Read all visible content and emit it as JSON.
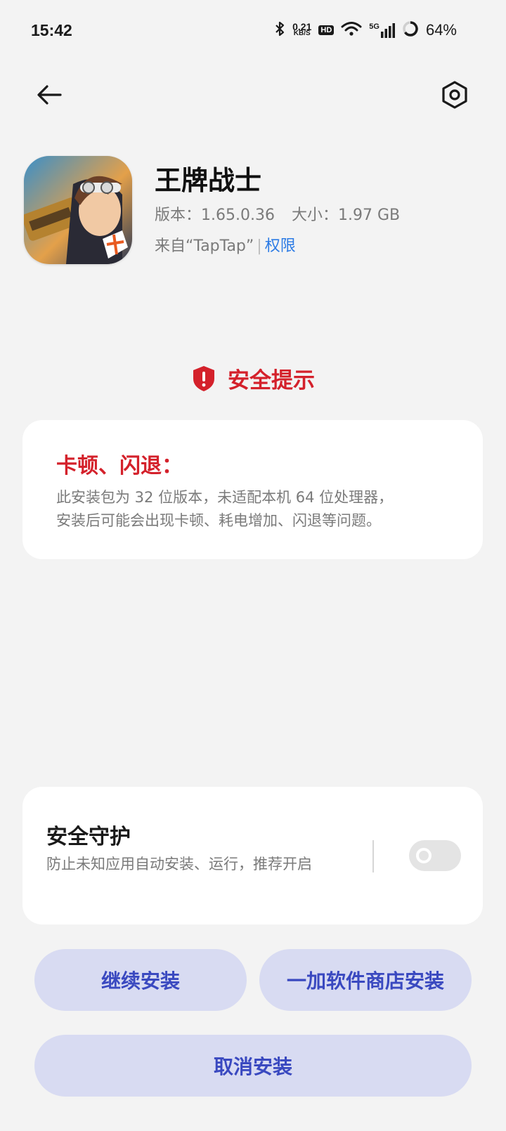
{
  "status_bar": {
    "time": "15:42",
    "net_speed_value": "0.21",
    "net_speed_unit": "KB/S",
    "hd_label": "HD",
    "network_type": "5G",
    "battery": "64%",
    "icons": [
      "bluetooth-icon",
      "hd-icon",
      "wifi-icon",
      "signal-icon",
      "battery-icon"
    ]
  },
  "header": {
    "back_icon": "back-arrow-icon",
    "settings_icon": "settings-hexagon-icon"
  },
  "app": {
    "name": "王牌战士",
    "version": "版本：1.65.0.36",
    "size": "大小：1.97 GB",
    "source": "来自“TapTap”",
    "permissions_link": "权限"
  },
  "warning": {
    "title": "安全提示",
    "headline": "卡顿、闪退：",
    "line1": "此安装包为 32 位版本，未适配本机 64 位处理器，",
    "line2": "安装后可能会出现卡顿、耗电增加、闪退等问题。",
    "accent_color": "#d4212b"
  },
  "protection": {
    "title": "安全守护",
    "description": "防止未知应用自动安装、运行，推荐开启",
    "toggle_on": false
  },
  "buttons": {
    "continue": "继续安装",
    "store_install": "一加软件商店安装",
    "cancel": "取消安装",
    "color": "#3a49c0",
    "background": "#d8dbf2"
  }
}
